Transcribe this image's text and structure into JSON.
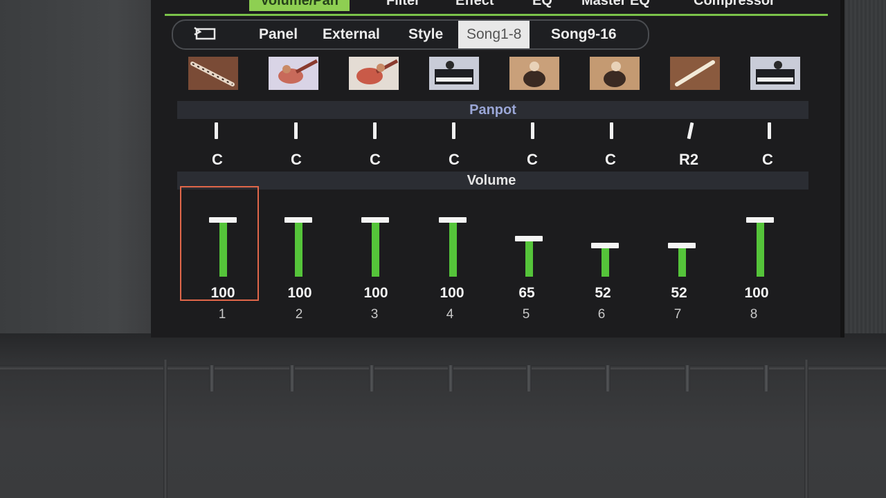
{
  "top_tabs": [
    {
      "label": "Volume/Pan",
      "active": true
    },
    {
      "label": "Filter",
      "active": false
    },
    {
      "label": "Effect",
      "active": false
    },
    {
      "label": "EQ",
      "active": false
    },
    {
      "label": "Master EQ",
      "active": false
    },
    {
      "label": "Compressor",
      "active": false
    }
  ],
  "sub_tabs": [
    {
      "label": "Panel",
      "active": false
    },
    {
      "label": "External",
      "active": false
    },
    {
      "label": "Style",
      "active": false
    },
    {
      "label": "Song1-8",
      "active": true
    },
    {
      "label": "Song9-16",
      "active": false
    }
  ],
  "return_icon": "return-icon",
  "sections": {
    "panpot": "Panpot",
    "volume": "Volume"
  },
  "channels": [
    {
      "number": "1",
      "instrument_icon": "clarinet-icon",
      "pan": "C",
      "volume": 100,
      "selected": true
    },
    {
      "number": "2",
      "instrument_icon": "guitar-icon",
      "pan": "C",
      "volume": 100,
      "selected": false
    },
    {
      "number": "3",
      "instrument_icon": "guitar-icon",
      "pan": "C",
      "volume": 100,
      "selected": false
    },
    {
      "number": "4",
      "instrument_icon": "piano-icon",
      "pan": "C",
      "volume": 100,
      "selected": false
    },
    {
      "number": "5",
      "instrument_icon": "drum-kit-icon",
      "pan": "C",
      "volume": 65,
      "selected": false
    },
    {
      "number": "6",
      "instrument_icon": "drum-kit-icon",
      "pan": "C",
      "volume": 52,
      "selected": false
    },
    {
      "number": "7",
      "instrument_icon": "flute-icon",
      "pan": "R2",
      "volume": 52,
      "selected": false
    },
    {
      "number": "8",
      "instrument_icon": "piano-icon",
      "pan": "C",
      "volume": 100,
      "selected": false
    }
  ],
  "colors": {
    "accent_green": "#8ecf52",
    "fader_green": "#55c43a",
    "selection_outline": "#e0674a"
  }
}
